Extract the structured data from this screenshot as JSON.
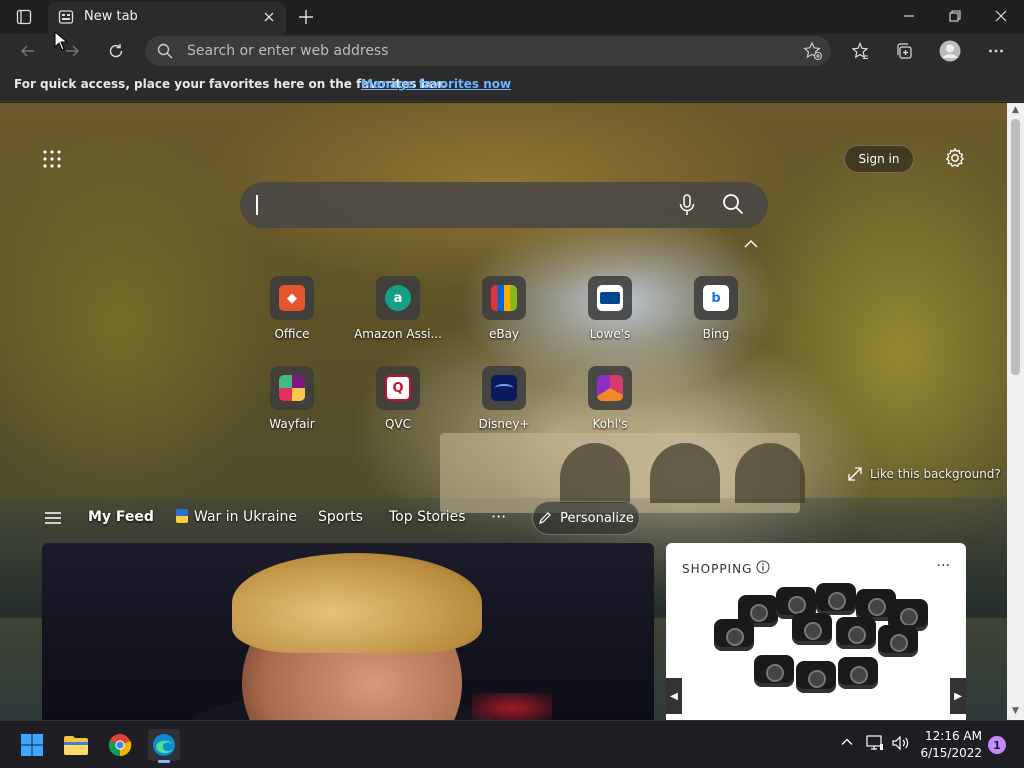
{
  "window": {
    "tab_title": "New tab"
  },
  "toolbar": {
    "address_placeholder": "Search or enter web address"
  },
  "favbar": {
    "message": "For quick access, place your favorites here on the favorites bar.",
    "link": "Manage favorites now"
  },
  "page": {
    "signin_label": "Sign in",
    "like_background": "Like this background?",
    "quick_links": [
      {
        "label": "Office",
        "color": "#e4572e",
        "glyph": "◆"
      },
      {
        "label": "Amazon Assi...",
        "color": "#14a085",
        "glyph": "a"
      },
      {
        "label": "eBay",
        "color": "#2a2a2a",
        "glyph": "▦"
      },
      {
        "label": "Lowe's",
        "color": "#004990",
        "glyph": "▭"
      },
      {
        "label": "Bing",
        "color": "#ffffff",
        "glyph": "b"
      },
      {
        "label": "Wayfair",
        "color": "#7f187f",
        "glyph": "✦"
      },
      {
        "label": "QVC",
        "color": "#ffffff",
        "glyph": "Q"
      },
      {
        "label": "Disney+",
        "color": "#0a1a5c",
        "glyph": "D"
      },
      {
        "label": "Kohl's",
        "color": "#d63c6b",
        "glyph": "K"
      }
    ]
  },
  "feed": {
    "my_feed": "My Feed",
    "ukraine": "War in Ukraine",
    "sports": "Sports",
    "top_stories": "Top Stories",
    "more": "···",
    "personalize": "Personalize"
  },
  "shopping": {
    "header": "SHOPPING",
    "more": "···"
  },
  "taskbar": {
    "time": "12:16 AM",
    "date": "6/15/2022",
    "notifications": "1"
  }
}
